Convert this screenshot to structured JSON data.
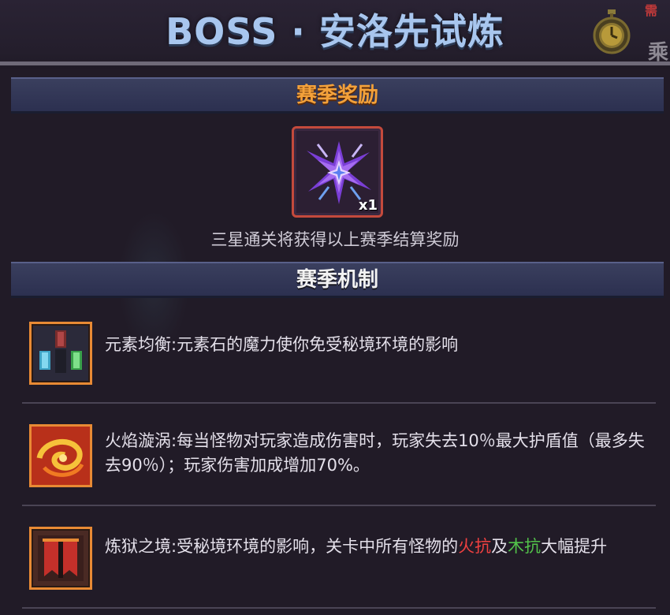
{
  "header": {
    "title": "BOSS · 安洛先试炼",
    "corner_red_text": "需",
    "corner_text": "乘",
    "timer_icon": "stopwatch-icon"
  },
  "reward_section": {
    "title": "赛季奖励",
    "item": {
      "icon": "purple-star-shard-icon",
      "quantity": "x1"
    },
    "note": "三星通关将获得以上赛季结算奖励"
  },
  "mechanics_section": {
    "title": "赛季机制",
    "items": [
      {
        "icon": "element-crystals-icon",
        "text": "元素均衡:元素石的魔力使你免受秘境环境的影响"
      },
      {
        "icon": "fire-vortex-icon",
        "text": "火焰漩涡:每当怪物对玩家造成伤害时，玩家失去10％最大护盾值（最多失去90％）；玩家伤害加成增加70%。"
      },
      {
        "icon": "purgatory-banner-icon",
        "text_before": "炼狱之境:受秘境环境的影响，关卡中所有怪物的",
        "highlight_fire": "火抗",
        "text_mid": "及",
        "highlight_wood": "木抗",
        "text_after": "大幅提升"
      }
    ]
  },
  "colors": {
    "title": "#a8c6ee",
    "reward_header": "#f3a13a",
    "fire_highlight": "#ee4040",
    "wood_highlight": "#52c24a"
  }
}
